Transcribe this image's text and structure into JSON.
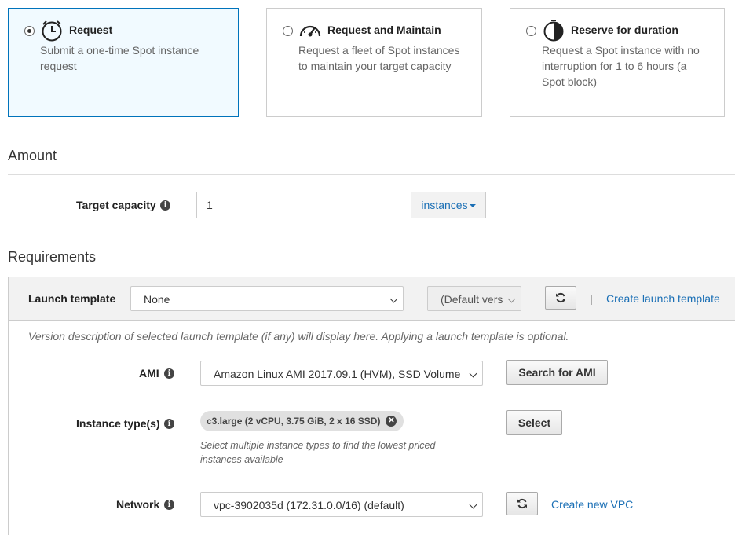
{
  "request_types": [
    {
      "title": "Request",
      "description": [
        "Submit a one-time Spot instance",
        "request"
      ],
      "selected": true,
      "icon": "clock-icon"
    },
    {
      "title": "Request and Maintain",
      "description": [
        "Request a fleet of Spot instances",
        "to maintain your target capacity"
      ],
      "selected": false,
      "icon": "gauge-icon"
    },
    {
      "title": "Reserve for duration",
      "description": [
        "Request a Spot instance with no",
        "interruption for 1 to 6 hours (a",
        "Spot block)"
      ],
      "selected": false,
      "icon": "timer-icon"
    }
  ],
  "amount": {
    "section_title": "Amount",
    "target_capacity_label": "Target capacity",
    "target_capacity_value": "1",
    "unit_dropdown": "instances"
  },
  "requirements": {
    "section_title": "Requirements",
    "launch_template_label": "Launch template",
    "launch_template_value": "None",
    "version_value": "(Default vers",
    "create_template_link": "Create launch template",
    "separator": "|",
    "version_note": "Version description of selected launch template (if any) will display here. Applying a launch template is optional.",
    "ami_label": "AMI",
    "ami_value": "Amazon Linux AMI 2017.09.1 (HVM), SSD Volume",
    "search_ami_button": "Search for AMI",
    "instance_types_label": "Instance type(s)",
    "instance_chip": "c3.large (2 vCPU, 3.75 GiB, 2 x 16 SSD)",
    "select_button": "Select",
    "instance_note": [
      "Select multiple instance types to find the lowest priced",
      "instances available"
    ],
    "network_label": "Network",
    "network_value": "vpc-3902035d (172.31.0.0/16) (default)",
    "create_vpc_link": "Create new VPC"
  },
  "colors": {
    "accent": "#1a6fb5",
    "selected_bg": "#f1faff",
    "selected_border": "#0073bb"
  }
}
